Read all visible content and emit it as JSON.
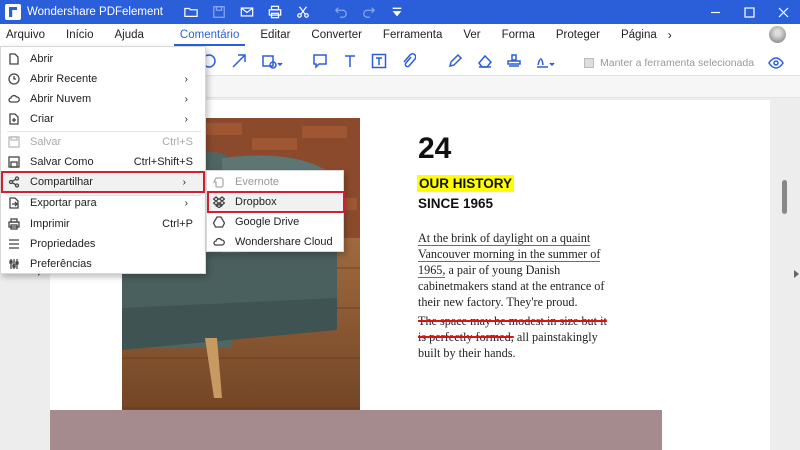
{
  "titlebar": {
    "title": "Wondershare PDFelement"
  },
  "menubar": {
    "items": [
      "Arquivo",
      "Início",
      "Ajuda",
      "Comentário",
      "Editar",
      "Converter",
      "Ferramenta",
      "Ver",
      "Forma",
      "Proteger",
      "Página"
    ],
    "active": "Comentário",
    "more": "›"
  },
  "toolbar": {
    "keep_tool_label": "Manter a ferramenta selecionada"
  },
  "file_menu": {
    "items": [
      {
        "label": "Abrir",
        "shortcut": "",
        "submenu": false,
        "icon": "file-icon"
      },
      {
        "label": "Abrir Recente",
        "shortcut": "",
        "submenu": true,
        "icon": "clock-icon"
      },
      {
        "label": "Abrir Nuvem",
        "shortcut": "",
        "submenu": true,
        "icon": "cloud-icon"
      },
      {
        "label": "Criar",
        "shortcut": "",
        "submenu": true,
        "icon": "new-file-icon"
      },
      {
        "label": "Salvar",
        "shortcut": "Ctrl+S",
        "submenu": false,
        "icon": "save-icon",
        "disabled": true
      },
      {
        "label": "Salvar Como",
        "shortcut": "Ctrl+Shift+S",
        "submenu": false,
        "icon": "save-as-icon"
      },
      {
        "label": "Compartilhar",
        "shortcut": "",
        "submenu": true,
        "icon": "share-icon",
        "selected": true
      },
      {
        "label": "Exportar para",
        "shortcut": "",
        "submenu": true,
        "icon": "export-icon"
      },
      {
        "label": "Imprimir",
        "shortcut": "Ctrl+P",
        "submenu": false,
        "icon": "print-icon"
      },
      {
        "label": "Propriedades",
        "shortcut": "",
        "submenu": false,
        "icon": "properties-icon"
      },
      {
        "label": "Preferências",
        "shortcut": "",
        "submenu": false,
        "icon": "preferences-icon"
      }
    ],
    "arrow": "›"
  },
  "share_menu": {
    "items": [
      {
        "label": "Evernote",
        "icon": "evernote-icon",
        "disabled": true
      },
      {
        "label": "Dropbox",
        "icon": "dropbox-icon",
        "selected": true
      },
      {
        "label": "Google Drive",
        "icon": "google-drive-icon"
      },
      {
        "label": "Wondershare Cloud",
        "icon": "cloud-icon"
      }
    ]
  },
  "document": {
    "number": "24",
    "heading_highlight": "OUR HISTORY",
    "heading_sub": "SINCE 1965",
    "para1_underlined": "At the brink of daylight on a quaint Vancouver morning in the summer of 1965,",
    "para1_rest": " a pair of young Danish cabinetmakers stand at the entrance of their new factory. They're proud.",
    "para2_struck": "The space may be modest in size but it is perfectly formed,",
    "para2_rest": " all painstakingly built by their hands."
  },
  "colors": {
    "accent": "#2b5fd9",
    "highlight": "#ffff00",
    "underline": "#2a9d2a",
    "strike": "#e01010",
    "selection_border": "#d32030"
  }
}
